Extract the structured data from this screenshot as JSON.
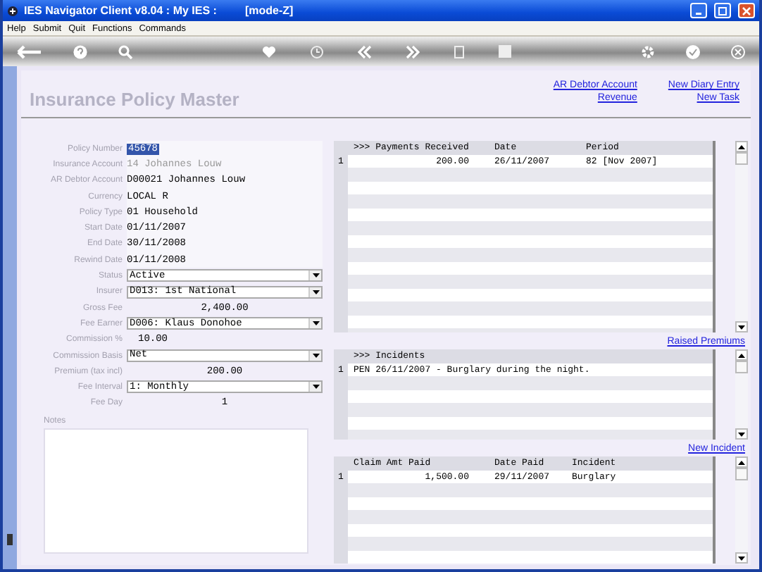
{
  "window": {
    "title": "IES Navigator Client v8.04 : My IES :",
    "mode": "[mode-Z]"
  },
  "menu": [
    "Help",
    "Submit",
    "Quit",
    "Functions",
    "Commands"
  ],
  "page_title": "Insurance Policy Master",
  "links": [
    "AR Debtor Account",
    "New Diary Entry",
    "Revenue",
    "New Task"
  ],
  "fields": [
    {
      "label": "Policy Number",
      "value": "45678",
      "kind": "text",
      "focused": true,
      "disabled": false
    },
    {
      "label": "Insurance Account",
      "value": "14 Johannes Louw",
      "kind": "text",
      "focused": false,
      "disabled": true
    },
    {
      "label": "AR Debtor Account",
      "value": "D00021 Johannes Louw",
      "kind": "text",
      "focused": false,
      "disabled": false
    },
    {
      "label": "Currency",
      "value": "LOCAL R",
      "kind": "text",
      "focused": false,
      "disabled": false
    },
    {
      "label": "Policy Type",
      "value": "01 Household",
      "kind": "text",
      "focused": false,
      "disabled": false
    },
    {
      "label": "Start Date",
      "value": "01/11/2007",
      "kind": "text",
      "focused": false,
      "disabled": false
    },
    {
      "label": "End Date",
      "value": "30/11/2008",
      "kind": "text",
      "focused": false,
      "disabled": false
    },
    {
      "label": "Rewind Date",
      "value": "01/11/2008",
      "kind": "text",
      "focused": false,
      "disabled": false
    },
    {
      "label": "Status",
      "value": "Active",
      "kind": "select",
      "focused": false,
      "disabled": false
    },
    {
      "label": "Insurer",
      "value": "D013: 1st National",
      "kind": "select",
      "focused": false,
      "disabled": false
    },
    {
      "label": "Gross Fee",
      "value": "2,400.00",
      "kind": "amount",
      "focused": false,
      "disabled": false
    },
    {
      "label": "Fee Earner",
      "value": "D006: Klaus Donohoe",
      "kind": "select",
      "focused": false,
      "disabled": false
    },
    {
      "label": "Commission %",
      "value": "10.00",
      "kind": "number",
      "focused": false,
      "disabled": false
    },
    {
      "label": "Commission Basis",
      "value": "Net",
      "kind": "select",
      "focused": false,
      "disabled": false
    },
    {
      "label": "Premium (tax incl)",
      "value": "200.00",
      "kind": "amount",
      "focused": false,
      "disabled": false
    },
    {
      "label": "Fee Interval",
      "value": "1: Monthly",
      "kind": "select",
      "focused": false,
      "disabled": false
    },
    {
      "label": "Fee Day",
      "value": "1",
      "kind": "amount",
      "focused": false,
      "disabled": false
    }
  ],
  "notes": {
    "label": "Notes"
  },
  "tables": [
    {
      "columns": [
        ">>> Payments Received",
        "Date",
        "Period"
      ],
      "rows": [
        {
          "number": "1",
          "cells": [
            "200.00",
            "26/11/2007",
            "82  [Nov 2007]"
          ]
        }
      ],
      "link": "Raised Premiums"
    },
    {
      "columns": [
        ">>> Incidents"
      ],
      "rows": [
        {
          "number": "1",
          "cells": [
            "PEN 26/11/2007 - Burglary during the night."
          ]
        }
      ],
      "link": "New Incident"
    },
    {
      "columns": [
        "Claim Amt Paid",
        "Date Paid",
        "Incident"
      ],
      "rows": [
        {
          "number": "1",
          "cells": [
            "1,500.00",
            "29/11/2007",
            "Burglary"
          ]
        }
      ]
    }
  ]
}
